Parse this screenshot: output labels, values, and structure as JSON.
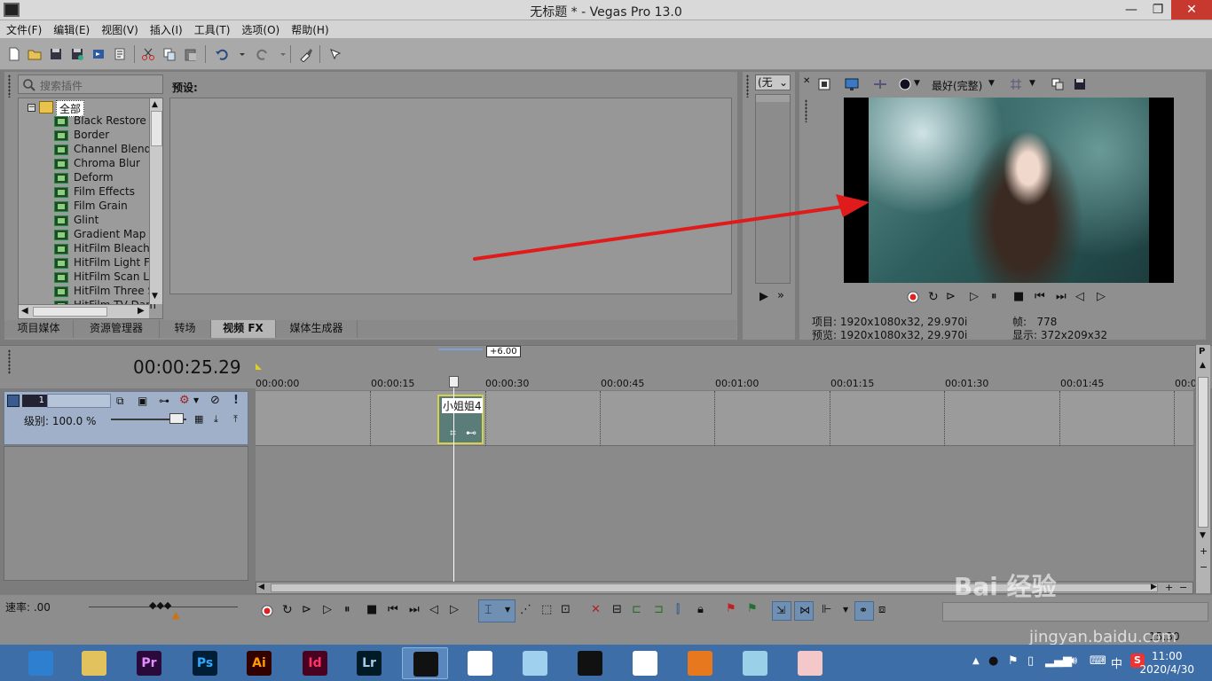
{
  "window": {
    "title": "无标题 * - Vegas Pro 13.0",
    "minimize": "—",
    "maximize": "❐",
    "close": "✕"
  },
  "menu": [
    "文件(F)",
    "编辑(E)",
    "视图(V)",
    "插入(I)",
    "工具(T)",
    "选项(O)",
    "帮助(H)"
  ],
  "plugins": {
    "search_placeholder": "搜索插件",
    "root": "全部",
    "items": [
      "Black Restore",
      "Border",
      "Channel Blend",
      "Chroma Blur",
      "Deform",
      "Film Effects",
      "Film Grain",
      "Glint",
      "Gradient Map",
      "HitFilm Bleach B",
      "HitFilm Light Fla",
      "HitFilm Scan Lin",
      "HitFilm Three St",
      "HitFilm TV Dam"
    ],
    "preset_label": "预设:"
  },
  "tabs": [
    {
      "label": "项目媒体",
      "active": false
    },
    {
      "label": "资源管理器",
      "active": false
    },
    {
      "label": "转场",
      "active": false
    },
    {
      "label": "视频 FX",
      "active": true
    },
    {
      "label": "媒体生成器",
      "active": false
    }
  ],
  "mid": {
    "select_value": "(无"
  },
  "preview": {
    "quality": "最好(完整)",
    "project_label": "项目:",
    "project_value": "1920x1080x32, 29.970i",
    "preview_label": "预览:",
    "preview_value": "1920x1080x32, 29.970i",
    "frame_label": "帧:",
    "frame_value": "778",
    "display_label": "显示:",
    "display_value": "372x209x32"
  },
  "timeline": {
    "timecode": "00:00:25.29",
    "offset": "+6.00",
    "ruler": [
      "00:00:00",
      "00:00:15",
      "00:00:30",
      "00:00:45",
      "00:01:00",
      "00:01:15",
      "00:01:30",
      "00:01:45",
      "00:0"
    ],
    "track_number": "1",
    "level": "级别: 100.0 %",
    "clip_name": "小姐姐4",
    "rate": "速率: .00"
  },
  "taskbar": {
    "apps": [
      {
        "name": "browser-app",
        "label": "",
        "bg": "#2f7fd0",
        "fg": "#ffffff"
      },
      {
        "name": "explorer-app",
        "label": "",
        "bg": "#e2c25c",
        "fg": "#5a4010"
      },
      {
        "name": "premiere-app",
        "label": "Pr",
        "bg": "#2a0a3a",
        "fg": "#e58cff"
      },
      {
        "name": "photoshop-app",
        "label": "Ps",
        "bg": "#001e36",
        "fg": "#31a8ff"
      },
      {
        "name": "illustrator-app",
        "label": "Ai",
        "bg": "#330000",
        "fg": "#ff9a00"
      },
      {
        "name": "indesign-app",
        "label": "Id",
        "bg": "#49021f",
        "fg": "#ff3366"
      },
      {
        "name": "lightroom-app",
        "label": "Lr",
        "bg": "#001a26",
        "fg": "#a8c8e8"
      },
      {
        "name": "vegas-app",
        "label": "",
        "bg": "#111111",
        "fg": "#ffffff"
      },
      {
        "name": "shield-app",
        "label": "",
        "bg": "#ffffff",
        "fg": "#d02020"
      },
      {
        "name": "bird-app",
        "label": "",
        "bg": "#9fd0ee",
        "fg": "#ffffff"
      },
      {
        "name": "qq-app",
        "label": "",
        "bg": "#111111",
        "fg": "#ffd000"
      },
      {
        "name": "chrome-app",
        "label": "",
        "bg": "#ffffff",
        "fg": "#d33"
      },
      {
        "name": "orange-app",
        "label": "",
        "bg": "#e8781e",
        "fg": "#ffffff"
      },
      {
        "name": "tablet-app",
        "label": "",
        "bg": "#9ad0e8",
        "fg": "#ffffff"
      },
      {
        "name": "mascot-app",
        "label": "",
        "bg": "#f4c8c8",
        "fg": "#c03030"
      }
    ],
    "ime": "中",
    "time": "11:00",
    "date": "2020/4/30",
    "watermark": "Bai 经验",
    "watermark_url": "jingyan.baidu.com",
    "status_partial": "15:30"
  },
  "colors": {
    "accent_taskbar": "#3d6ea8",
    "track_header": "#9fb0c8",
    "arrow": "#e01b1b",
    "clip_border": "#d6d04a"
  }
}
